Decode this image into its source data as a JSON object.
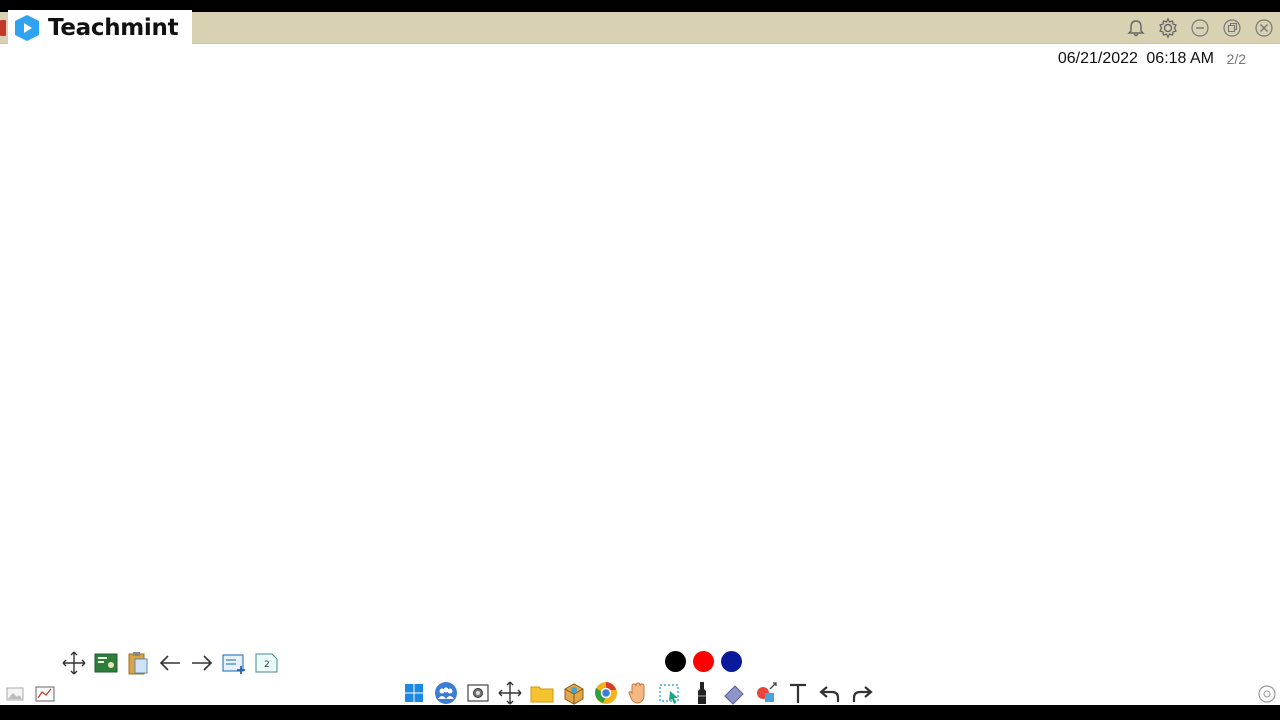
{
  "app": {
    "title": "Teachmint",
    "brand_color": "#2ea3f2",
    "titlebar_color": "#d8d2b2"
  },
  "window_controls": [
    "bell-icon",
    "gear-icon",
    "minimize-icon",
    "restore-icon",
    "close-icon"
  ],
  "status": {
    "date": "06/21/2022",
    "time": "06:18 AM",
    "page_indicator": "2/2"
  },
  "page_toolbar": {
    "items": [
      "move-icon",
      "whiteboard-icon",
      "clipboard-icon",
      "previous-page-icon",
      "next-page-icon",
      "add-page-icon",
      "page-count-icon"
    ],
    "page_count": "2"
  },
  "pen_colors": [
    "#000000",
    "#ff0000",
    "#0a1a9a"
  ],
  "dock": {
    "items": [
      "windows-icon",
      "participants-icon",
      "screenshot-icon",
      "move-icon",
      "folder-icon",
      "box-icon",
      "browser-icon",
      "hand-icon",
      "select-icon",
      "marker-icon",
      "eraser-icon",
      "shapes-icon",
      "text-icon",
      "undo-icon",
      "redo-icon"
    ]
  }
}
